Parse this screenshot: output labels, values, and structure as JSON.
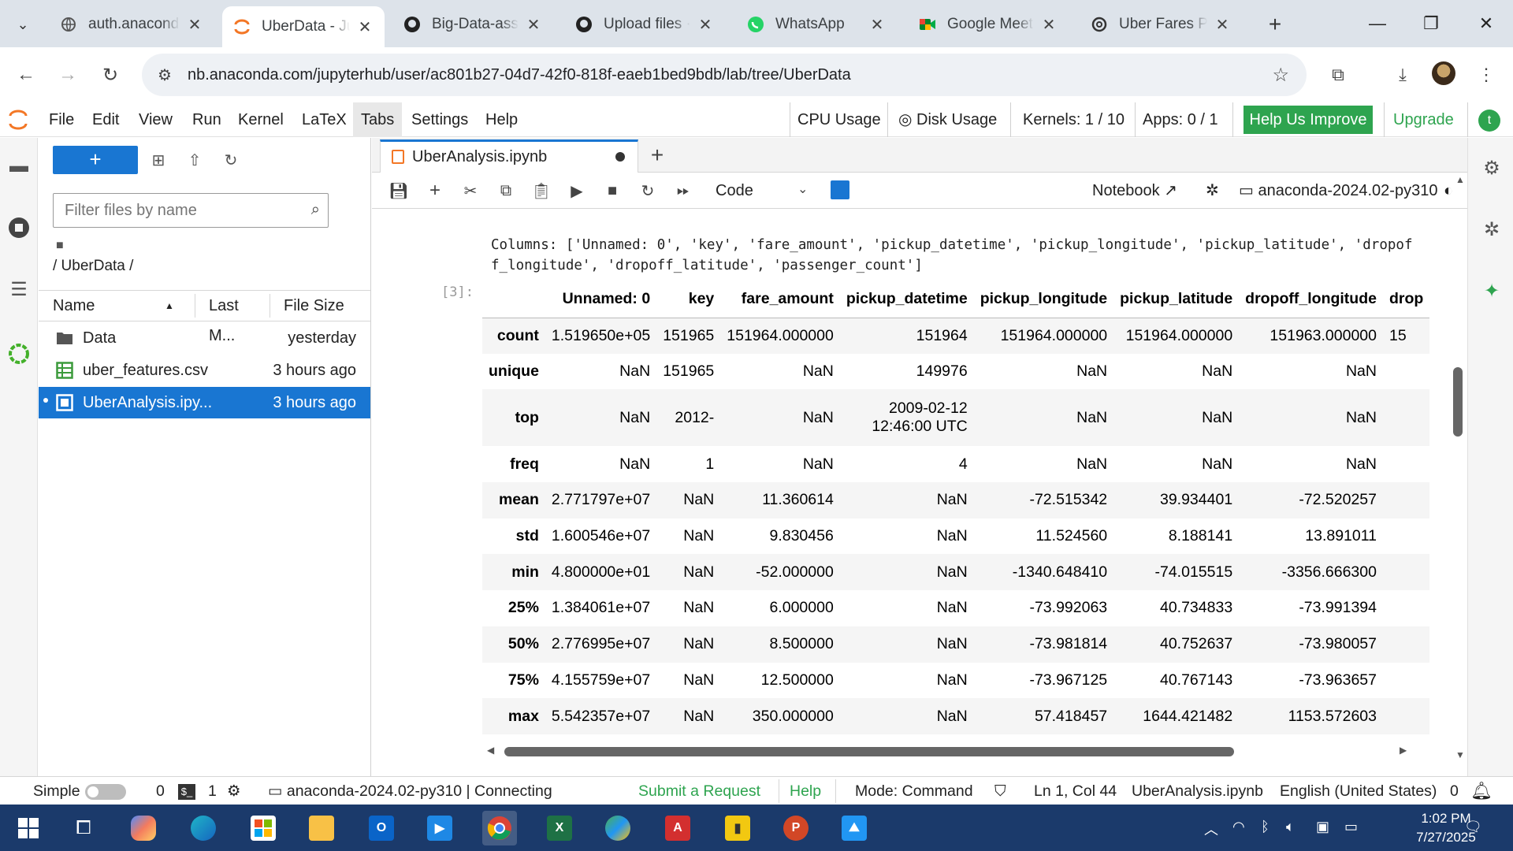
{
  "browser": {
    "tabs": [
      {
        "title": "auth.anaconda",
        "active": false
      },
      {
        "title": "UberData - Ju",
        "active": true
      },
      {
        "title": "Big-Data-assig",
        "active": false
      },
      {
        "title": "Upload files · t",
        "active": false
      },
      {
        "title": "WhatsApp",
        "active": false
      },
      {
        "title": "Google Meet",
        "active": false
      },
      {
        "title": "Uber Fares Pc",
        "active": false
      }
    ],
    "url": "nb.anaconda.com/jupyterhub/user/ac801b27-04d7-42f0-818f-eaeb1bed9bdb/lab/tree/UberData"
  },
  "menubar": {
    "items": [
      "File",
      "Edit",
      "View",
      "Run",
      "Kernel",
      "LaTeX",
      "Tabs",
      "Settings",
      "Help"
    ],
    "cpu": "CPU Usage",
    "disk": "Disk Usage",
    "kernels": "Kernels: 1 / 10",
    "apps": "Apps: 0 / 1",
    "help_improve": "Help Us Improve",
    "upgrade": "Upgrade",
    "user_initial": "t"
  },
  "filebrowser": {
    "new_label": "+",
    "filter_placeholder": "Filter files by name",
    "breadcrumb": "/ UberData /",
    "columns": {
      "name": "Name",
      "modified": "Last M...",
      "size": "File Size"
    },
    "files": [
      {
        "name": "Data",
        "modified": "yesterday",
        "type": "folder"
      },
      {
        "name": "uber_features.csv",
        "modified": "3 hours ago",
        "type": "csv"
      },
      {
        "name": "UberAnalysis.ipy...",
        "modified": "3 hours ago",
        "type": "notebook",
        "selected": true
      }
    ]
  },
  "notebook": {
    "tab_title": "UberAnalysis.ipynb",
    "cell_type": "Code",
    "notebook_label": "Notebook",
    "kernel": "anaconda-2024.02-py310",
    "prompt": "[3]:",
    "columns_text": "Columns: ['Unnamed: 0', 'key', 'fare_amount', 'pickup_datetime', 'pickup_longitude', 'pickup_latitude', 'dropoff_longitude', 'dropoff_latitude', 'passenger_count']",
    "table": {
      "columns": [
        "Unnamed: 0",
        "key",
        "fare_amount",
        "pickup_datetime",
        "pickup_longitude",
        "pickup_latitude",
        "dropoff_longitude",
        "drop"
      ],
      "rows": [
        {
          "label": "count",
          "cells": [
            "1.519650e+05",
            "151965",
            "151964.000000",
            "151964",
            "151964.000000",
            "151964.000000",
            "151963.000000",
            "15"
          ]
        },
        {
          "label": "unique",
          "cells": [
            "NaN",
            "151965",
            "NaN",
            "149976",
            "NaN",
            "NaN",
            "NaN",
            ""
          ]
        },
        {
          "label": "top",
          "cells": [
            "NaN",
            "2012-",
            "NaN",
            "2009-02-12\n12:46:00 UTC",
            "NaN",
            "NaN",
            "NaN",
            ""
          ]
        },
        {
          "label": "freq",
          "cells": [
            "NaN",
            "1",
            "NaN",
            "4",
            "NaN",
            "NaN",
            "NaN",
            ""
          ]
        },
        {
          "label": "mean",
          "cells": [
            "2.771797e+07",
            "NaN",
            "11.360614",
            "NaN",
            "-72.515342",
            "39.934401",
            "-72.520257",
            ""
          ]
        },
        {
          "label": "std",
          "cells": [
            "1.600546e+07",
            "NaN",
            "9.830456",
            "NaN",
            "11.524560",
            "8.188141",
            "13.891011",
            ""
          ]
        },
        {
          "label": "min",
          "cells": [
            "4.800000e+01",
            "NaN",
            "-52.000000",
            "NaN",
            "-1340.648410",
            "-74.015515",
            "-3356.666300",
            ""
          ]
        },
        {
          "label": "25%",
          "cells": [
            "1.384061e+07",
            "NaN",
            "6.000000",
            "NaN",
            "-73.992063",
            "40.734833",
            "-73.991394",
            ""
          ]
        },
        {
          "label": "50%",
          "cells": [
            "2.776995e+07",
            "NaN",
            "8.500000",
            "NaN",
            "-73.981814",
            "40.752637",
            "-73.980057",
            ""
          ]
        },
        {
          "label": "75%",
          "cells": [
            "4.155759e+07",
            "NaN",
            "12.500000",
            "NaN",
            "-73.967125",
            "40.767143",
            "-73.963657",
            ""
          ]
        },
        {
          "label": "max",
          "cells": [
            "5.542357e+07",
            "NaN",
            "350.000000",
            "NaN",
            "57.418457",
            "1644.421482",
            "1153.572603",
            ""
          ]
        }
      ]
    }
  },
  "statusbar": {
    "simple": "Simple",
    "terminals": "0",
    "kernels_count": "1",
    "kernel_status": "anaconda-2024.02-py310 | Connecting",
    "submit": "Submit a Request",
    "help": "Help",
    "mode": "Mode: Command",
    "position": "Ln 1, Col 44",
    "filename": "UberAnalysis.ipynb",
    "language": "English (United States)",
    "notifications": "0"
  },
  "taskbar": {
    "time": "1:02 PM",
    "date": "7/27/2025"
  },
  "colors": {
    "jupyter_blue": "#1976d2",
    "anaconda_green": "#2ea44f",
    "taskbar": "#1b3a6b"
  }
}
